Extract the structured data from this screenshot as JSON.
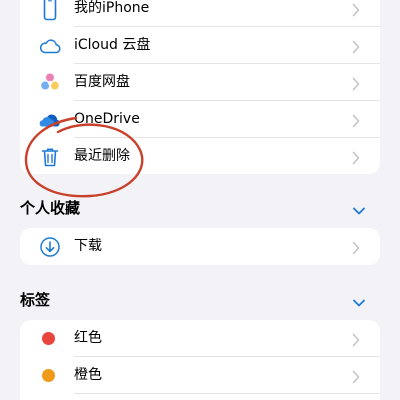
{
  "locations": {
    "items": [
      {
        "label": "我的iPhone",
        "icon": "phone-icon"
      },
      {
        "label": "iCloud 云盘",
        "icon": "icloud-icon"
      },
      {
        "label": "百度网盘",
        "icon": "baidu-netdisk-icon"
      },
      {
        "label": "OneDrive",
        "icon": "onedrive-icon"
      },
      {
        "label": "最近删除",
        "icon": "trash-icon"
      }
    ]
  },
  "favorites": {
    "title": "个人收藏",
    "items": [
      {
        "label": "下载",
        "icon": "download-icon"
      }
    ]
  },
  "tags": {
    "title": "标签",
    "items": [
      {
        "label": "红色",
        "color": "#e8453c"
      },
      {
        "label": "橙色",
        "color": "#f09a1a"
      }
    ]
  },
  "colors": {
    "accent": "#1f7ad6",
    "annotation": "#c8402a"
  }
}
